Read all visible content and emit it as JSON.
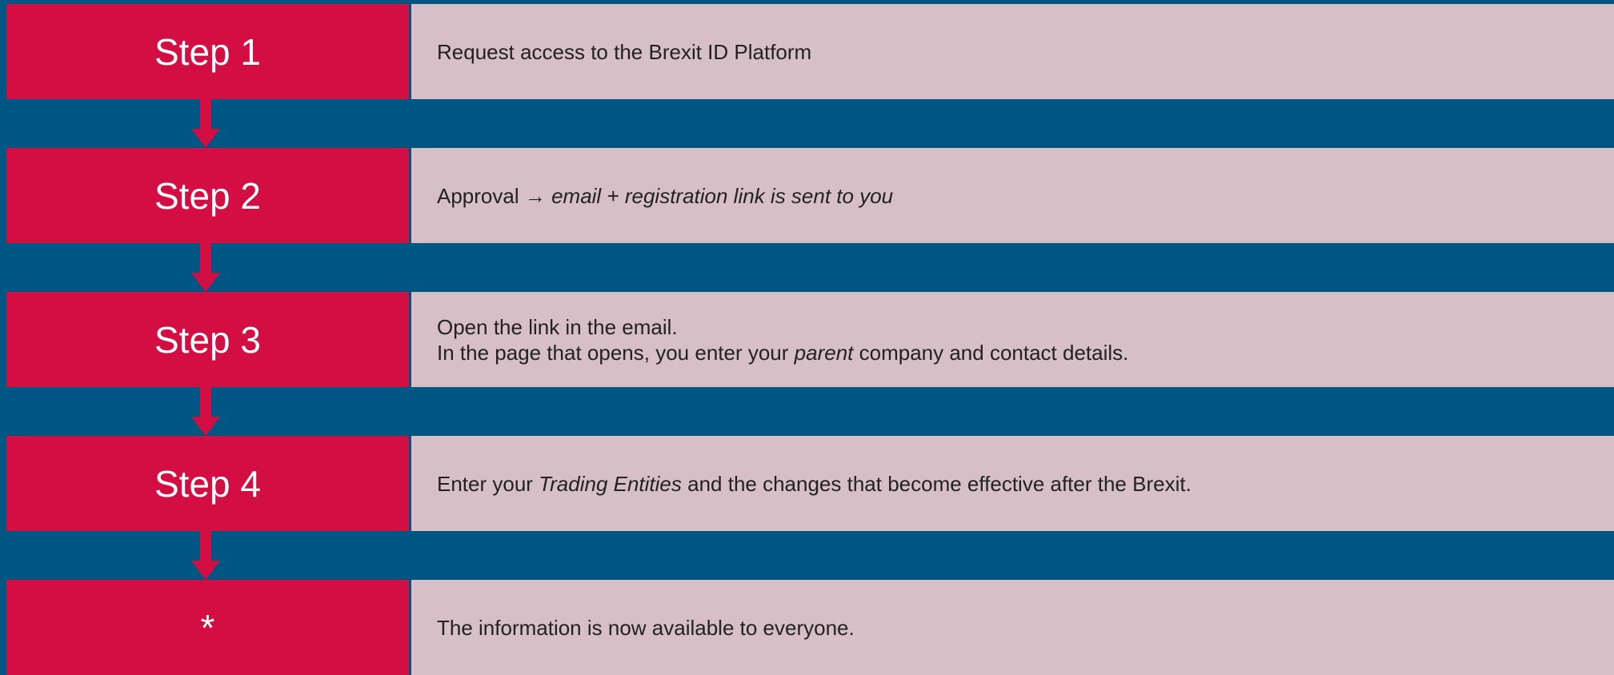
{
  "steps": [
    {
      "label": "Step 1",
      "lines": [
        [
          {
            "t": "Request access to the Brexit ID Platform"
          }
        ]
      ]
    },
    {
      "label": "Step 2",
      "lines": [
        [
          {
            "t": "Approval "
          },
          {
            "t": "→"
          },
          {
            "t": " "
          },
          {
            "t": "email + registration link is sent to you",
            "i": true
          }
        ]
      ]
    },
    {
      "label": "Step 3",
      "lines": [
        [
          {
            "t": "Open the link in the email."
          }
        ],
        [
          {
            "t": "In the page that opens, you enter your "
          },
          {
            "t": "parent",
            "i": true
          },
          {
            "t": " company and contact details."
          }
        ]
      ]
    },
    {
      "label": "Step 4",
      "lines": [
        [
          {
            "t": "Enter your "
          },
          {
            "t": "Trading Entities",
            "i": true
          },
          {
            "t": " and the changes that become effective after the Brexit."
          }
        ]
      ]
    },
    {
      "label": "*",
      "lines": [
        [
          {
            "t": "The information is now available to everyone."
          }
        ]
      ]
    }
  ]
}
